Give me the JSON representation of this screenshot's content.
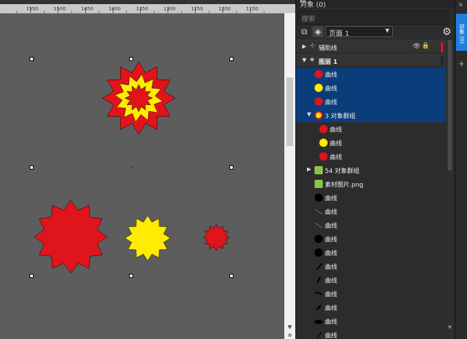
{
  "ruler": {
    "labels": [
      "1550",
      "1500",
      "1450",
      "1400",
      "1350",
      "1300",
      "1250",
      "1200",
      "1150"
    ]
  },
  "objects_panel": {
    "title": "对象 (0)",
    "search_placeholder": "搜索",
    "page_select": "页面 1",
    "rows": [
      {
        "label": "辅助线",
        "icon": "guides-icon",
        "kind": "guides"
      },
      {
        "label": "图层 1",
        "icon": "layer-icon",
        "kind": "layer"
      },
      {
        "label": "曲线",
        "icon": "red-star-icon",
        "color": "#e0141c",
        "selected": true
      },
      {
        "label": "曲线",
        "icon": "yellow-star-icon",
        "color": "#ffec00",
        "selected": true
      },
      {
        "label": "曲线",
        "icon": "red-star-icon",
        "color": "#e0141c",
        "selected": true
      },
      {
        "label": "3 对象群组",
        "icon": "group-icon",
        "selected": true
      },
      {
        "label": "曲线",
        "icon": "red-star-icon",
        "color": "#e0141c"
      },
      {
        "label": "曲线",
        "icon": "yellow-star-icon",
        "color": "#ffec00"
      },
      {
        "label": "曲线",
        "icon": "red-star-icon",
        "color": "#e0141c"
      },
      {
        "label": "54 对象群组",
        "icon": "image-group-icon"
      },
      {
        "label": "素材图片.png",
        "icon": "image-icon"
      },
      {
        "label": "曲线",
        "icon": "black-circle-icon"
      },
      {
        "label": "曲线",
        "icon": "line-icon"
      },
      {
        "label": "曲线",
        "icon": "line-icon"
      },
      {
        "label": "曲线",
        "icon": "black-circle-icon"
      },
      {
        "label": "曲线",
        "icon": "black-circle-icon"
      },
      {
        "label": "曲线",
        "icon": "brush-stroke-icon"
      },
      {
        "label": "曲线",
        "icon": "brush-stroke-icon"
      },
      {
        "label": "曲线",
        "icon": "curve-stroke-icon"
      },
      {
        "label": "曲线",
        "icon": "brush-stroke-icon"
      },
      {
        "label": "曲线",
        "icon": "leaf-stroke-icon"
      },
      {
        "label": "曲线",
        "icon": "brush-stroke-icon"
      }
    ]
  },
  "docker_tab": {
    "label": "对象 (0)"
  },
  "colors": {
    "red": "#e0141c",
    "yellow": "#ffec00",
    "selection": "#0b3d7a",
    "accent": "#1e7fe0"
  }
}
